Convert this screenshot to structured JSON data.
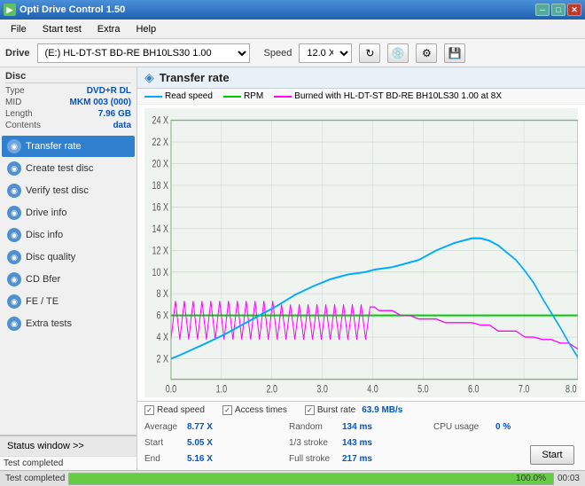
{
  "window": {
    "title": "Opti Drive Control 1.50",
    "icon": "disc-icon",
    "controls": [
      "minimize",
      "maximize",
      "close"
    ]
  },
  "menu": {
    "items": [
      "File",
      "Start test",
      "Extra",
      "Help"
    ]
  },
  "drive_bar": {
    "drive_label": "Drive",
    "drive_value": "(E:)  HL-DT-ST BD-RE  BH10LS30 1.00",
    "speed_label": "Speed",
    "speed_value": "12.0 X",
    "refresh_icon": "↻",
    "disc_icon": "💿",
    "settings_icon": "⚙",
    "save_icon": "💾"
  },
  "disc": {
    "section_title": "Disc",
    "rows": [
      {
        "label": "Type",
        "value": "DVD+R DL"
      },
      {
        "label": "MID",
        "value": "MKM 003 (000)"
      },
      {
        "label": "Length",
        "value": "7.96 GB"
      },
      {
        "label": "Contents",
        "value": "data"
      }
    ]
  },
  "nav": {
    "items": [
      {
        "id": "transfer-rate",
        "label": "Transfer rate",
        "active": true
      },
      {
        "id": "create-test-disc",
        "label": "Create test disc",
        "active": false
      },
      {
        "id": "verify-test-disc",
        "label": "Verify test disc",
        "active": false
      },
      {
        "id": "drive-info",
        "label": "Drive info",
        "active": false
      },
      {
        "id": "disc-info",
        "label": "Disc info",
        "active": false
      },
      {
        "id": "disc-quality",
        "label": "Disc quality",
        "active": false
      },
      {
        "id": "cd-bfer",
        "label": "CD Bfer",
        "active": false
      },
      {
        "id": "fe-te",
        "label": "FE / TE",
        "active": false
      },
      {
        "id": "extra-tests",
        "label": "Extra tests",
        "active": false
      }
    ]
  },
  "status_window_btn": "Status window >>",
  "status_text": "Test completed",
  "chart": {
    "title": "Transfer rate",
    "icon": "chart-icon",
    "legend": {
      "read_speed": "Read speed",
      "rpm": "RPM",
      "burned": "Burned with HL-DT-ST BD-RE  BH10LS30 1.00 at 8X"
    },
    "y_axis": [
      "24 X",
      "22 X",
      "20 X",
      "18 X",
      "16 X",
      "14 X",
      "12 X",
      "10 X",
      "8 X",
      "6 X",
      "4 X",
      "2 X"
    ],
    "x_axis": [
      "0.0",
      "1.0",
      "2.0",
      "3.0",
      "4.0",
      "5.0",
      "6.0",
      "7.0",
      "8.0 GB"
    ]
  },
  "checkboxes": {
    "read_speed": {
      "label": "Read speed",
      "checked": true
    },
    "access_times": {
      "label": "Access times",
      "checked": true
    },
    "burst_rate": {
      "label": "Burst rate",
      "checked": true,
      "value": "63.9 MB/s"
    }
  },
  "stats": {
    "average_label": "Average",
    "average_value": "8.77 X",
    "start_label": "Start",
    "start_value": "5.05 X",
    "end_label": "End",
    "end_value": "5.16 X",
    "random_label": "Random",
    "random_value": "134 ms",
    "onethird_label": "1/3 stroke",
    "onethird_value": "143 ms",
    "full_label": "Full stroke",
    "full_value": "217 ms",
    "cpu_label": "CPU usage",
    "cpu_value": "0 %",
    "start_btn": "Start"
  },
  "progress": {
    "completed_label": "Test completed",
    "percent": "100.0%",
    "time": "00:03"
  }
}
